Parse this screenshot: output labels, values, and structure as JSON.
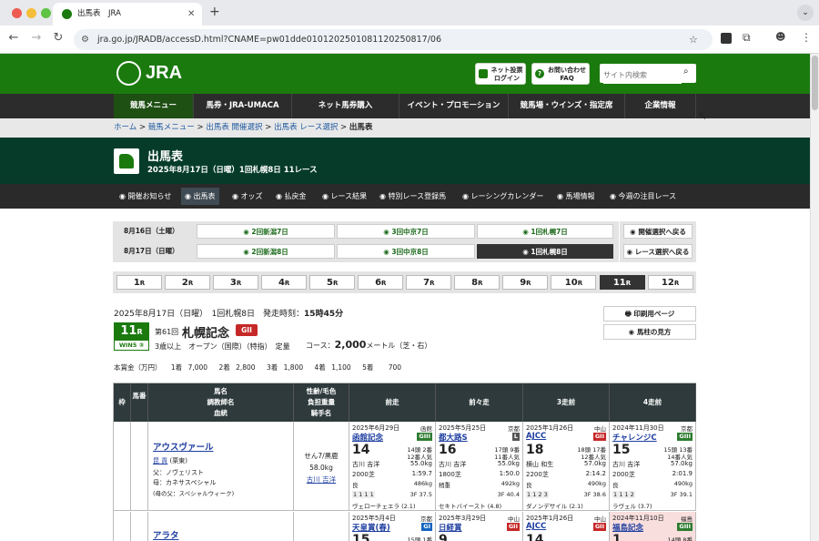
{
  "browser": {
    "tab_title": "出馬表　JRA",
    "url": "jra.go.jp/JRADB/accessD.html?CNAME=pw01dde0101202501081120250817/06"
  },
  "header": {
    "logo": "JRA",
    "net_vote_label": "ネット投票\nログイン",
    "faq_label": "お問い合わせ\nFAQ",
    "search_placeholder": "サイト内検索"
  },
  "nav": [
    "競馬メニュー",
    "馬券・JRA-UMACA",
    "ネット馬券購入",
    "イベント・プロモーション",
    "競馬場・ウインズ・指定席",
    "企業情報"
  ],
  "breadcrumb": [
    "ホーム",
    "競馬メニュー",
    "出馬表 開催選択",
    "出馬表 レース選択",
    "出馬表"
  ],
  "page": {
    "title": "出馬表",
    "subtitle": "2025年8月17日（日曜）1回札幌8日 11レース"
  },
  "subnav": [
    "開催お知らせ",
    "出馬表",
    "オッズ",
    "払戻金",
    "レース結果",
    "特別レース登録馬",
    "レーシングカレンダー",
    "馬場情報",
    "今週の注目レース"
  ],
  "days": [
    {
      "label": "8月16日（土曜）",
      "meets": [
        "2回新潟7日",
        "3回中京7日",
        "1回札幌7日"
      ]
    },
    {
      "label": "8月17日（日曜）",
      "meets": [
        "2回新潟8日",
        "3回中京8日",
        "1回札幌8日"
      ]
    }
  ],
  "back_buttons": [
    "開催選択へ戻る",
    "レース選択へ戻る"
  ],
  "races": [
    "1",
    "2",
    "3",
    "4",
    "5",
    "6",
    "7",
    "8",
    "9",
    "10",
    "11",
    "12"
  ],
  "race_unit": "R",
  "selected_race": "11",
  "race": {
    "date_line": "2025年8月17日（日曜）　1回札幌8日　発走時刻：",
    "start_time": "15時45分",
    "number": "11",
    "unit": "R",
    "edition": "第61回",
    "name": "札幌記念",
    "grade": "GII",
    "conditions": "3歳以上　オープン（国際）（特指）　定量",
    "course_label": "コース：",
    "distance": "2,000",
    "course_detail": "メートル（芝・右）",
    "badge": "WIN5 ③",
    "prize_label": "本賞金（万円）",
    "prizes": [
      {
        "rank": "1着",
        "value": "7,000"
      },
      {
        "rank": "2着",
        "value": "2,800"
      },
      {
        "rank": "3着",
        "value": "1,800"
      },
      {
        "rank": "4着",
        "value": "1,100"
      },
      {
        "rank": "5着",
        "value": "700"
      }
    ]
  },
  "side_buttons": [
    "印刷用ページ",
    "馬柱の見方"
  ],
  "table": {
    "headers": {
      "waku": "枠",
      "umaban": "馬番",
      "horse": "馬名\n調教師名\n血統",
      "info": "性齢/毛色\n負担重量\n騎手名",
      "prev1": "前走",
      "prev2": "前々走",
      "prev3": "3走前",
      "prev4": "4走前"
    },
    "rows": [
      {
        "horse": "アウスヴァール",
        "trainer": "昆 貢",
        "trainer_area": "(栗東)",
        "sire": "父：ノヴェリスト",
        "dam": "母：カネサスペシャル",
        "damsire": "(母の父：スペシャルウィーク)",
        "sex_age": "せん7/黒鹿",
        "weight": "58.0kg",
        "jockey": "古川 吉洋",
        "runs": [
          {
            "date": "2025年6月29日",
            "course": "函館",
            "race": "函館記念",
            "grade": "GIII",
            "gcolor": "#2e7d32",
            "place": "14",
            "heads": "14頭 2番",
            "pop": "12番人気",
            "jockey": "古川 吉洋",
            "wt": "55.0kg",
            "dist": "2000芝",
            "time": "1:59.7",
            "cond": "良",
            "hw": "486kg",
            "last": "3F 37.5",
            "pos": "1 1 1 1",
            "winner": "ヴェローチェエラ (2.1)"
          },
          {
            "date": "2025年5月25日",
            "course": "京都",
            "race": "都大路S",
            "grade": "L",
            "gcolor": "#555",
            "place": "16",
            "heads": "17頭 9番",
            "pop": "11番人気",
            "jockey": "古川 吉洋",
            "wt": "55.0kg",
            "dist": "1800芝",
            "time": "1:50.0",
            "cond": "稍重",
            "hw": "492kg",
            "last": "3F 40.4",
            "pos": "",
            "winner": "セキトバイースト (4.8)"
          },
          {
            "date": "2025年1月26日",
            "course": "中山",
            "race": "AJCC",
            "grade": "GII",
            "gcolor": "#c62828",
            "place": "18",
            "heads": "18頭 17番",
            "pop": "12番人気",
            "jockey": "横山 和生",
            "wt": "57.0kg",
            "dist": "2200芝",
            "time": "2:14.2",
            "cond": "良",
            "hw": "490kg",
            "last": "3F 38.6",
            "pos": "1 1 2 3",
            "winner": "ダノンデサイル (2.1)"
          },
          {
            "date": "2024年11月30日",
            "course": "京都",
            "race": "チャレンジC",
            "grade": "GIII",
            "gcolor": "#2e7d32",
            "place": "15",
            "heads": "15頭 13番",
            "pop": "14番人気",
            "jockey": "古川 吉洋",
            "wt": "57.0kg",
            "dist": "2000芝",
            "time": "2:01.9",
            "cond": "良",
            "hw": "490kg",
            "last": "3F 39.1",
            "pos": "1 1 1 2",
            "winner": "ラヴェル (3.7)"
          }
        ]
      },
      {
        "horse": "アラタ",
        "runs": [
          {
            "date": "2025年5月4日",
            "course": "京都",
            "race": "天皇賞(春)",
            "grade": "GI",
            "gcolor": "#1565c0",
            "place": "15",
            "heads": "15頭 1番"
          },
          {
            "date": "2025年3月29日",
            "course": "中山",
            "race": "日経賞",
            "grade": "GII",
            "gcolor": "#c62828",
            "place": "9",
            "heads": ""
          },
          {
            "date": "2025年1月26日",
            "course": "中山",
            "race": "AJCC",
            "grade": "GII",
            "gcolor": "#c62828",
            "place": "14",
            "heads": ""
          },
          {
            "date": "2024年11月10日",
            "course": "福島",
            "race": "福島記念",
            "grade": "GIII",
            "gcolor": "#2e7d32",
            "place": "1",
            "heads": "14頭 8番"
          }
        ]
      }
    ]
  }
}
